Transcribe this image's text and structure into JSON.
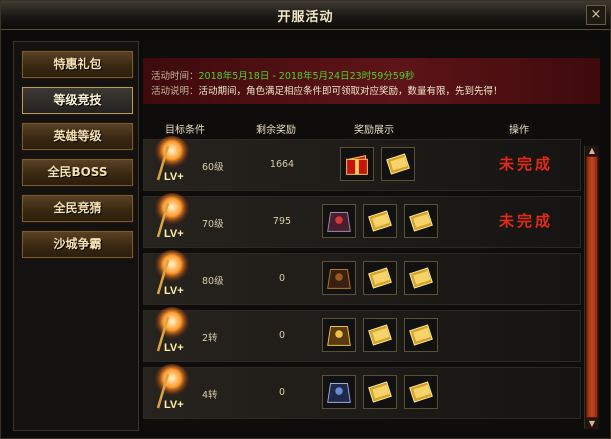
{
  "window": {
    "title": "开服活动",
    "close_label": "×"
  },
  "sidebar": {
    "items": [
      {
        "label": "特惠礼包"
      },
      {
        "label": "等级竞技"
      },
      {
        "label": "英雄等级"
      },
      {
        "label": "全民BOSS"
      },
      {
        "label": "全民竞猜"
      },
      {
        "label": "沙城争霸"
      }
    ],
    "active_index": 1
  },
  "banner": {
    "time_label": "活动时间：",
    "time_value": "2018年5月18日 - 2018年5月24日23时59分59秒",
    "desc_label": "活动说明：",
    "desc_value": "活动期间，角色满足相应条件即可领取对应奖励，数量有限，先到先得！"
  },
  "table": {
    "headers": {
      "target": "目标条件",
      "remain": "剩余奖励",
      "rewards": "奖励展示",
      "action": "操作"
    },
    "rows": [
      {
        "level": "60级",
        "remain": "1664",
        "status": "未完成",
        "rewards": [
          "red-gift-box-icon",
          "gold-ingot-stack-icon"
        ]
      },
      {
        "level": "70级",
        "remain": "795",
        "status": "未完成",
        "rewards": [
          "armor-red-icon",
          "gold-ingot-stack-icon",
          "gold-ingot-stack-icon"
        ]
      },
      {
        "level": "80级",
        "remain": "0",
        "status": "",
        "rewards": [
          "armor-dark-icon",
          "gold-ingot-stack-icon",
          "gold-ingot-stack-icon"
        ]
      },
      {
        "level": "2转",
        "remain": "0",
        "status": "",
        "rewards": [
          "armor-gold-icon",
          "gold-ingot-stack-icon",
          "gold-ingot-stack-icon"
        ]
      },
      {
        "level": "4转",
        "remain": "0",
        "status": "",
        "rewards": [
          "armor-blue-icon",
          "gold-ingot-stack-icon",
          "gold-ingot-stack-icon"
        ]
      }
    ]
  },
  "colors": {
    "status_red": "#e12a1a",
    "time_green": "#4ed12e",
    "banner_red": "#5e1418",
    "scroll_orange": "#c5441c"
  }
}
